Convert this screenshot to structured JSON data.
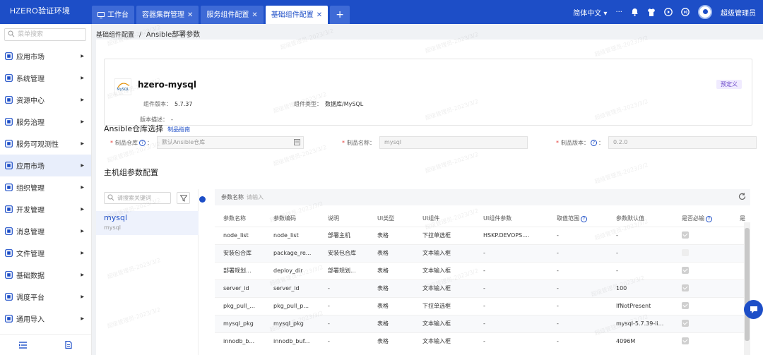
{
  "app": {
    "title": "HZERO验证环境"
  },
  "tabs": [
    {
      "label": "工作台"
    },
    {
      "label": "容器集群管理"
    },
    {
      "label": "服务组件配置"
    },
    {
      "label": "基础组件配置"
    }
  ],
  "topbar": {
    "language": "简体中文",
    "user": "超级管理员"
  },
  "sidebar": {
    "search_placeholder": "菜单搜索",
    "items": [
      {
        "label": "应用市场",
        "icon": "cube-icon"
      },
      {
        "label": "系统管理",
        "icon": "gear-box-icon"
      },
      {
        "label": "资源中心",
        "icon": "cube-icon"
      },
      {
        "label": "服务治理",
        "icon": "panel-icon"
      },
      {
        "label": "服务可观测性",
        "icon": "panel-icon"
      },
      {
        "label": "应用市场",
        "icon": "cube-icon"
      },
      {
        "label": "组织管理",
        "icon": "org-icon"
      },
      {
        "label": "开发管理",
        "icon": "panel-icon"
      },
      {
        "label": "消息管理",
        "icon": "message-icon"
      },
      {
        "label": "文件管理",
        "icon": "folder-icon"
      },
      {
        "label": "基础数据",
        "icon": "database-icon"
      },
      {
        "label": "调度平台",
        "icon": "schedule-icon"
      },
      {
        "label": "通用导入",
        "icon": "import-icon"
      }
    ]
  },
  "breadcrumb": {
    "parent": "基础组件配置",
    "sep": "/",
    "current": "Ansible部署参数"
  },
  "component": {
    "logo_text": "MySQL",
    "name": "hzero-mysql",
    "tag": "预定义",
    "version_label": "组件版本：",
    "version": "5.7.37",
    "type_label": "组件类型：",
    "type": "数据库/MySQL",
    "desc_label": "版本描述：",
    "desc": "-"
  },
  "repo": {
    "title": "Ansible仓库选择",
    "guide_link": "制品指南",
    "repo_label": "制品仓库",
    "repo_placeholder": "默认Ansible仓库",
    "artifact_label": "制品名称：",
    "artifact_value": "mysql",
    "version_label": "制品版本：",
    "version_value": "0.2.0"
  },
  "host_config": {
    "title": "主机组参数配置",
    "search_placeholder": "请搜索关键词",
    "node": {
      "name": "mysql",
      "sub": "mysql"
    }
  },
  "param_table": {
    "search_label": "参数名称",
    "search_placeholder": "请输入",
    "columns": [
      "参数名称",
      "参数编码",
      "说明",
      "UI类型",
      "UI组件",
      "UI组件参数",
      "取值范围",
      "参数默认值",
      "是否必输",
      "是"
    ],
    "rows": [
      {
        "name": "node_list",
        "code": "node_list",
        "desc": "部署主机",
        "ui_type": "表格",
        "ui_comp": "下拉单选框",
        "ui_param": "HSKP.DEVOPS....",
        "range": "-",
        "default": "-",
        "required": true
      },
      {
        "name": "安装包合库",
        "code": "package_re...",
        "desc": "安装包合库",
        "ui_type": "表格",
        "ui_comp": "文本输入框",
        "ui_param": "-",
        "range": "-",
        "default": "-",
        "required": false
      },
      {
        "name": "部署规划...",
        "code": "deploy_dir",
        "desc": "部署规划...",
        "ui_type": "表格",
        "ui_comp": "文本输入框",
        "ui_param": "-",
        "range": "-",
        "default": "-",
        "required": true
      },
      {
        "name": "server_id",
        "code": "server_id",
        "desc": "-",
        "ui_type": "表格",
        "ui_comp": "文本输入框",
        "ui_param": "-",
        "range": "-",
        "default": "100",
        "required": true
      },
      {
        "name": "pkg_pull_...",
        "code": "pkg_pull_p...",
        "desc": "-",
        "ui_type": "表格",
        "ui_comp": "下拉单选框",
        "ui_param": "-",
        "range": "-",
        "default": "IfNotPresent",
        "required": true
      },
      {
        "name": "mysql_pkg",
        "code": "mysql_pkg",
        "desc": "-",
        "ui_type": "表格",
        "ui_comp": "文本输入框",
        "ui_param": "-",
        "range": "-",
        "default": "mysql-5.7.39-li...",
        "required": true
      },
      {
        "name": "innodb_b...",
        "code": "innodb_buf...",
        "desc": "-",
        "ui_type": "表格",
        "ui_comp": "文本输入框",
        "ui_param": "-",
        "range": "-",
        "default": "4096M",
        "required": true
      }
    ]
  },
  "watermark": "超级管理员-2023/3/2",
  "colors": {
    "primary": "#1d4ec7",
    "tag_bg": "#f0ebff",
    "tag_text": "#6b48c9",
    "required": "#e53935"
  }
}
